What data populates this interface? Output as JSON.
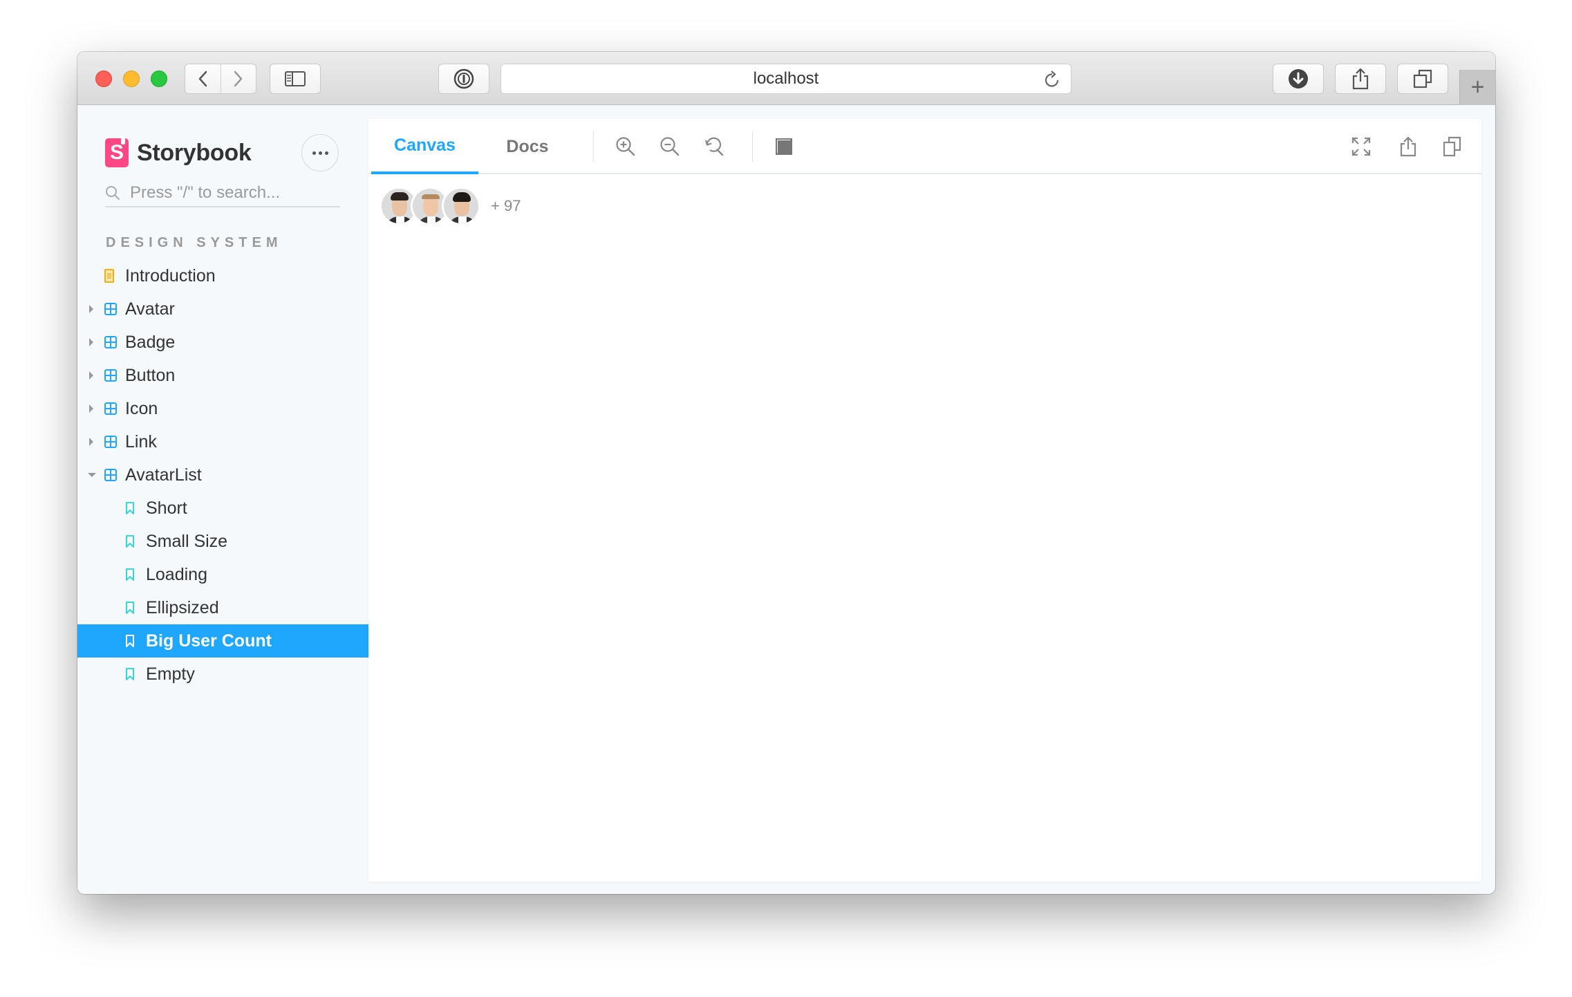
{
  "browser": {
    "url": "localhost",
    "buttons": {
      "back": "back-icon",
      "forward": "forward-icon",
      "sidebar": "sidebar-icon",
      "password": "password-manager-icon",
      "reload": "reload-icon",
      "download": "download-icon",
      "share": "share-icon",
      "tabs": "tabs-icon",
      "new_tab": "+"
    }
  },
  "sidebar": {
    "brand": "Storybook",
    "logo_letter": "S",
    "search_placeholder": "Press \"/\" to search...",
    "section_title": "DESIGN SYSTEM",
    "items": [
      {
        "label": "Introduction",
        "type": "doc",
        "expandable": false
      },
      {
        "label": "Avatar",
        "type": "component",
        "expandable": true,
        "expanded": false
      },
      {
        "label": "Badge",
        "type": "component",
        "expandable": true,
        "expanded": false
      },
      {
        "label": "Button",
        "type": "component",
        "expandable": true,
        "expanded": false
      },
      {
        "label": "Icon",
        "type": "component",
        "expandable": true,
        "expanded": false
      },
      {
        "label": "Link",
        "type": "component",
        "expandable": true,
        "expanded": false
      },
      {
        "label": "AvatarList",
        "type": "component",
        "expandable": true,
        "expanded": true
      }
    ],
    "stories": [
      {
        "label": "Short",
        "active": false
      },
      {
        "label": "Small Size",
        "active": false
      },
      {
        "label": "Loading",
        "active": false
      },
      {
        "label": "Ellipsized",
        "active": false
      },
      {
        "label": "Big User Count",
        "active": true
      },
      {
        "label": "Empty",
        "active": false
      }
    ]
  },
  "toolbar": {
    "tabs": [
      {
        "label": "Canvas",
        "active": true
      },
      {
        "label": "Docs",
        "active": false
      }
    ],
    "tools": [
      "zoom-in-icon",
      "zoom-out-icon",
      "zoom-reset-icon",
      "background-icon"
    ],
    "right_tools": [
      "fullscreen-icon",
      "share-icon",
      "copy-icon"
    ]
  },
  "canvas": {
    "avatar_count_shown": 3,
    "more_label": "+ 97"
  },
  "colors": {
    "accent": "#1ea7fd",
    "brand": "#ff4785",
    "doc_icon": "#ffae00",
    "component_icon": "#1ea7fd",
    "story_icon": "#37d5d3"
  }
}
